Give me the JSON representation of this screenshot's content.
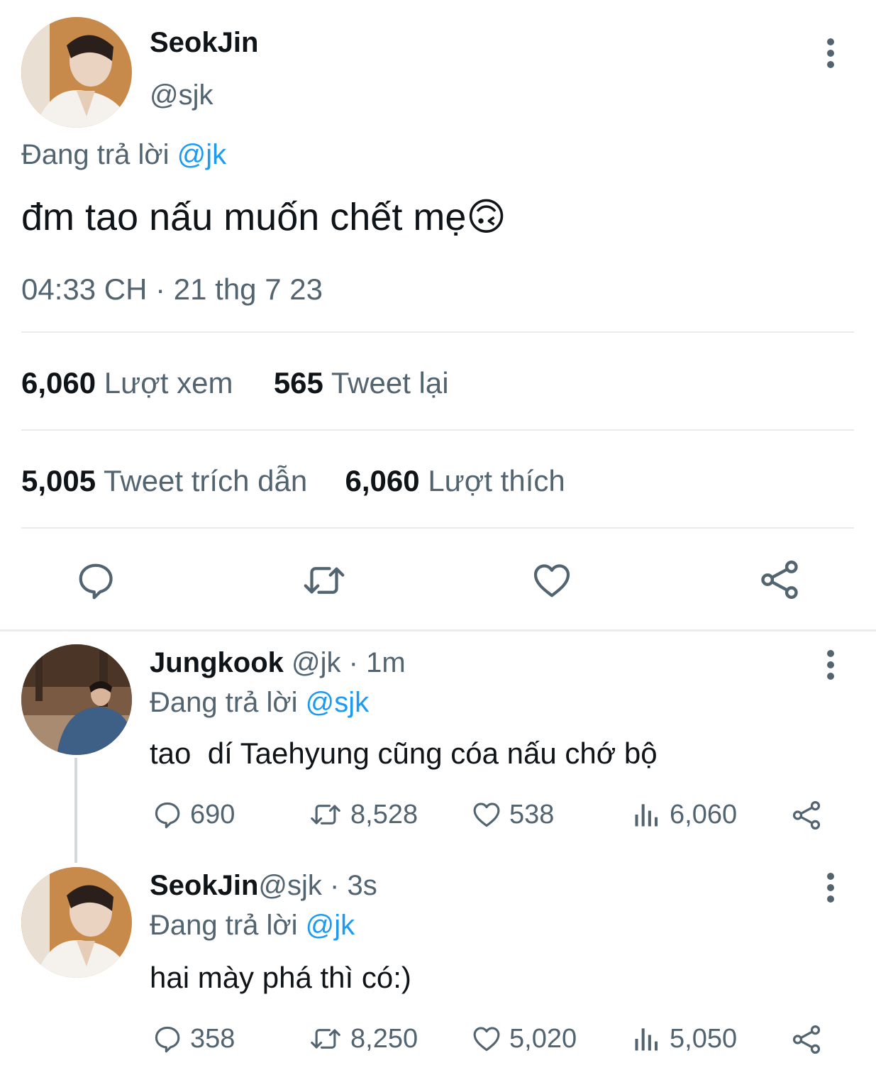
{
  "main_tweet": {
    "display_name": "SeokJin",
    "handle": "@sjk",
    "replying_label": "Đang trả lời",
    "replying_to": "@jk",
    "text": "đm tao nấu muốn chết mẹ",
    "emoji": "🙃",
    "timestamp": "04:33 CH · 21 thg 7 23",
    "views_count": "6,060",
    "views_label": "Lượt xem",
    "retweets_count": "565",
    "retweets_label": "Tweet lại",
    "quotes_count": "5,005",
    "quotes_label": "Tweet trích dẫn",
    "likes_count": "6,060",
    "likes_label": "Lượt thích"
  },
  "replies": [
    {
      "display_name": "Jungkook",
      "handle": "@jk",
      "time": "· 1m",
      "replying_label": "Đang trả lời",
      "replying_to": "@sjk",
      "text": "tao  dí Taehyung cũng cóa nấu chớ bộ",
      "replies": "690",
      "retweets": "8,528",
      "likes": "538",
      "views": "6,060"
    },
    {
      "display_name": "SeokJin",
      "handle": "@sjk",
      "time": "· 3s",
      "replying_label": "Đang trả lời",
      "replying_to": "@jk",
      "text": "hai mày phá thì có:)",
      "replies": "358",
      "retweets": "8,250",
      "likes": "5,020",
      "views": "5,050"
    }
  ],
  "colors": {
    "text": "#0f1419",
    "secondary": "#536471",
    "link": "#1d9bf0",
    "divider": "#e8ecef"
  },
  "icons": [
    "more-icon",
    "reply-icon",
    "retweet-icon",
    "like-icon",
    "share-icon",
    "views-icon"
  ]
}
